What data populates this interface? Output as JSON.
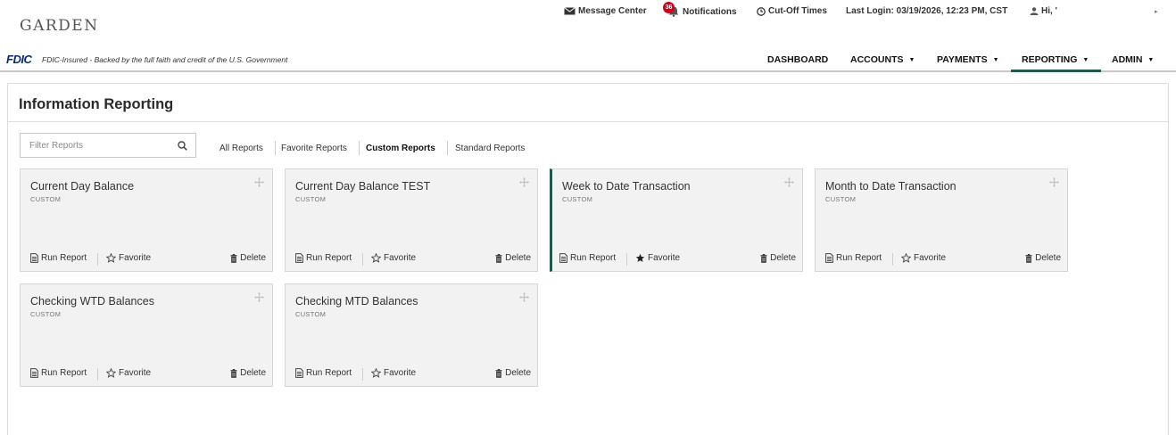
{
  "header": {
    "logo": "GARDEN",
    "message_center": "Message Center",
    "notifications_count": "36",
    "notifications": "Notifications",
    "cutoff_times": "Cut-Off Times",
    "last_login": "Last Login: 03/19/2026, 12:23 PM, CST",
    "greeting": "Hi, '"
  },
  "fdic": {
    "logo": "FDIC",
    "text": "FDIC-Insured - Backed by the full faith and credit of the U.S. Government"
  },
  "nav": {
    "items": [
      {
        "label": "DASHBOARD",
        "dropdown": false
      },
      {
        "label": "ACCOUNTS",
        "dropdown": true
      },
      {
        "label": "PAYMENTS",
        "dropdown": true
      },
      {
        "label": "REPORTING",
        "dropdown": true,
        "active": true
      },
      {
        "label": "ADMIN",
        "dropdown": true
      }
    ]
  },
  "page": {
    "title": "Information Reporting",
    "filter_placeholder": "Filter Reports",
    "tabs": [
      {
        "label": "All Reports",
        "active": false
      },
      {
        "label": "Favorite Reports",
        "active": false
      },
      {
        "label": "Custom Reports",
        "active": true
      },
      {
        "label": "Standard Reports",
        "active": false
      }
    ]
  },
  "cards": [
    {
      "title": "Current Day Balance",
      "type": "CUSTOM",
      "favorited": false,
      "active": false
    },
    {
      "title": "Current Day Balance TEST",
      "type": "CUSTOM",
      "favorited": false,
      "active": false
    },
    {
      "title": "Week to Date Transaction",
      "type": "CUSTOM",
      "favorited": true,
      "active": true
    },
    {
      "title": "Month to Date Transaction",
      "type": "CUSTOM",
      "favorited": false,
      "active": false
    },
    {
      "title": "Checking WTD Balances",
      "type": "CUSTOM",
      "favorited": false,
      "active": false
    },
    {
      "title": "Checking MTD Balances",
      "type": "CUSTOM",
      "favorited": false,
      "active": false
    }
  ],
  "card_actions": {
    "run": "Run Report",
    "favorite": "Favorite",
    "delete": "Delete"
  },
  "colors": {
    "accent": "#1f5a4d",
    "badge": "#d0021b",
    "card_bg": "#f2f2f2"
  }
}
